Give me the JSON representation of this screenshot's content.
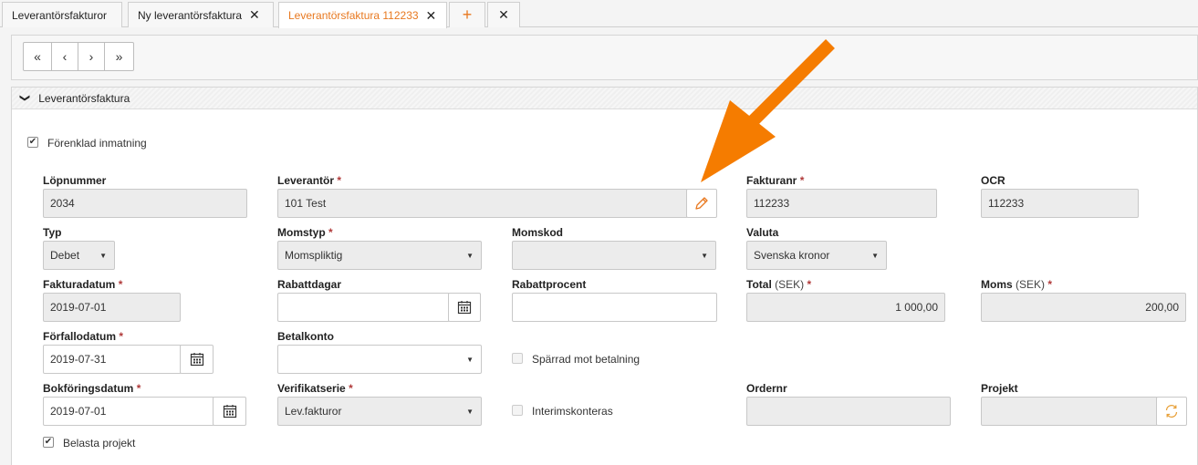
{
  "tabs": [
    {
      "label": "Leverantörsfakturor",
      "closable": false,
      "active": false
    },
    {
      "label": "Ny leverantörsfaktura",
      "closable": true,
      "active": false
    },
    {
      "label": "Leverantörsfaktura 112233",
      "closable": true,
      "active": true
    }
  ],
  "tab_actions": {
    "plus": "+",
    "close": "✕"
  },
  "nav": {
    "first": "«",
    "prev": "‹",
    "next": "›",
    "last": "»"
  },
  "section": {
    "title": "Leverantörsfaktura",
    "chevron": "❯"
  },
  "simplified_entry": {
    "label": "Förenklad inmatning",
    "checked": true
  },
  "fields": {
    "lopnummer": {
      "label": "Löpnummer",
      "value": "2034"
    },
    "leverantor": {
      "label": "Leverantör",
      "value": "101 Test"
    },
    "fakturanr": {
      "label": "Fakturanr",
      "value": "112233"
    },
    "ocr": {
      "label": "OCR",
      "value": "112233"
    },
    "typ": {
      "label": "Typ",
      "value": "Debet"
    },
    "momstyp": {
      "label": "Momstyp",
      "value": "Momspliktig"
    },
    "momskod": {
      "label": "Momskod",
      "value": ""
    },
    "valuta": {
      "label": "Valuta",
      "value": "Svenska kronor"
    },
    "fakturadatum": {
      "label": "Fakturadatum",
      "value": "2019-07-01"
    },
    "rabattdagar": {
      "label": "Rabattdagar",
      "value": ""
    },
    "rabattprocent": {
      "label": "Rabattprocent",
      "value": ""
    },
    "total": {
      "label": "Total",
      "unit": "(SEK)",
      "value": "1 000,00"
    },
    "moms": {
      "label": "Moms",
      "unit": "(SEK)",
      "value": "200,00"
    },
    "forfallodatum": {
      "label": "Förfallodatum",
      "value": "2019-07-31"
    },
    "betalkonto": {
      "label": "Betalkonto",
      "value": ""
    },
    "sparrad": {
      "label": "Spärrad mot betalning",
      "checked": false
    },
    "bokforingsdatum": {
      "label": "Bokföringsdatum",
      "value": "2019-07-01"
    },
    "verifikatserie": {
      "label": "Verifikatserie",
      "value": "Lev.fakturor"
    },
    "interimskonteras": {
      "label": "Interimskonteras",
      "checked": false
    },
    "ordernr": {
      "label": "Ordernr",
      "value": ""
    },
    "projekt": {
      "label": "Projekt",
      "value": ""
    },
    "belasta_projekt": {
      "label": "Belasta projekt",
      "checked": true
    }
  },
  "required_marker": "*",
  "check_glyph": "✔",
  "select_arrow": "▼",
  "colors": {
    "accent": "#e8781f",
    "required": "#b03a3a",
    "annotation_arrow": "#f57c00"
  },
  "icons": [
    "pencil-icon",
    "calendar-icon",
    "refresh-icon",
    "chevron-down-icon",
    "close-icon",
    "plus-icon"
  ]
}
